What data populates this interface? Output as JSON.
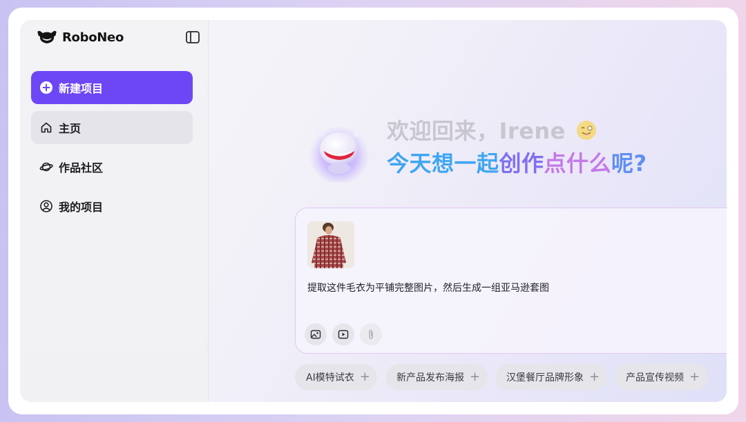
{
  "brand": {
    "name": "RoboNeo"
  },
  "sidebar": {
    "items": [
      {
        "label": "新建项目",
        "icon": "plus-circle-icon"
      },
      {
        "label": "主页",
        "icon": "home-icon"
      },
      {
        "label": "作品社区",
        "icon": "planet-icon"
      },
      {
        "label": "我的项目",
        "icon": "user-icon"
      }
    ]
  },
  "hero": {
    "greeting": "欢迎回来，Irene",
    "greeting_emoji": "winking-face-with-tongue-emoji",
    "tagline_parts": [
      "今天想一起",
      "创作",
      "点什么",
      "呢?"
    ]
  },
  "composer": {
    "prompt": "提取这件毛衣为平铺完整图片，然后生成一组亚马逊套图",
    "attachment": "sweater-photo",
    "tools": [
      "image-tool-icon",
      "video-tool-icon",
      "attach-icon"
    ]
  },
  "suggestions": [
    "AI模特试衣",
    "新产品发布海报",
    "汉堡餐厅品牌形象",
    "产品宣传视频"
  ],
  "colors": {
    "accent": "#6d47f5",
    "tagline_blue": "#3fa6f2",
    "tagline_purple": "#7f6ff1",
    "tagline_pink": "#c479e8"
  }
}
